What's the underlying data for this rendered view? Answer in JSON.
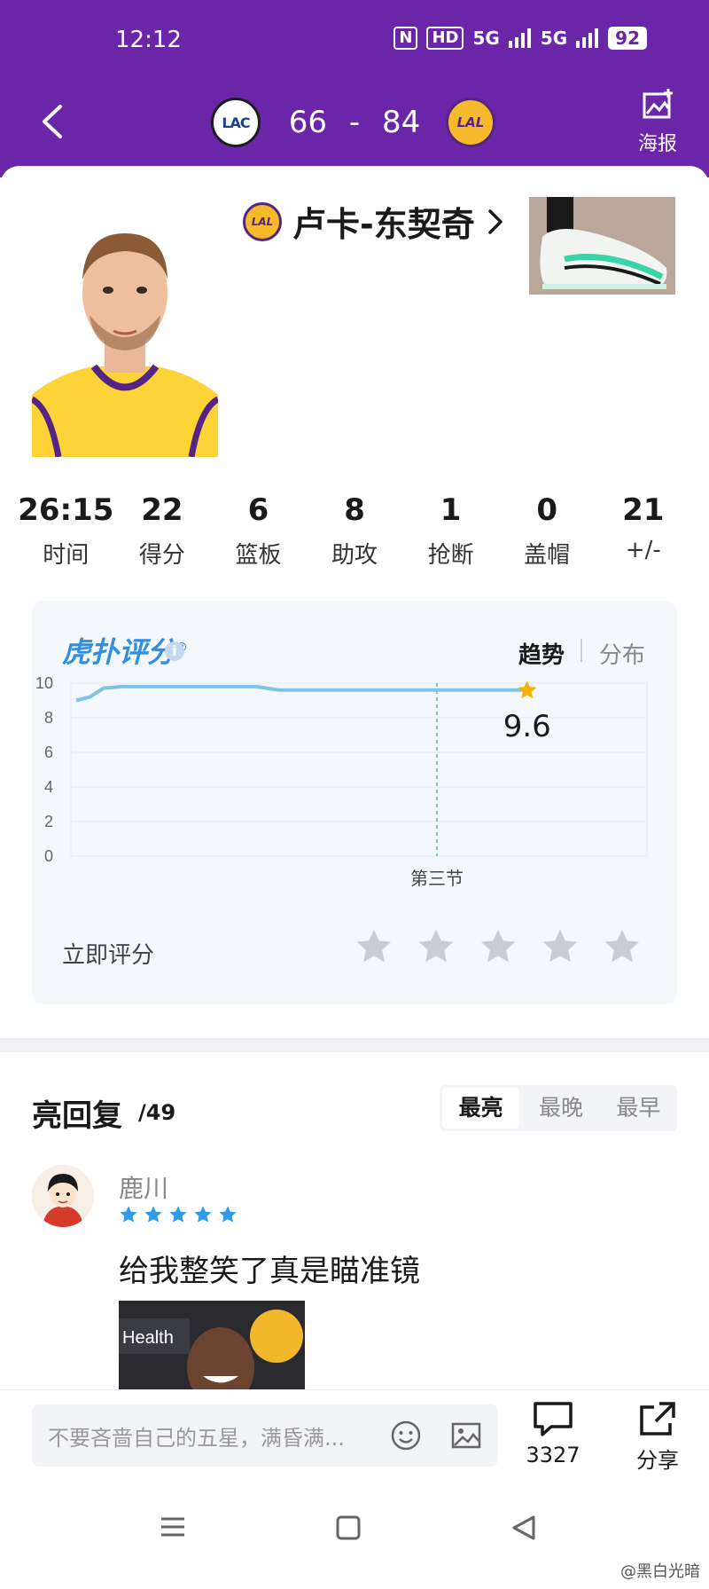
{
  "status_bar": {
    "time": "12:12",
    "nfc": "N",
    "hd": "HD",
    "sig1": "5G",
    "sig2": "5G",
    "battery": "92"
  },
  "header": {
    "home_team_abbr": "LAC",
    "away_team_abbr": "LAL",
    "home_score": "66",
    "score_separator": "-",
    "away_score": "84",
    "poster_label": "海报"
  },
  "player": {
    "name": "卢卡-东契奇",
    "team_abbr": "LAL"
  },
  "stats": [
    {
      "value": "26:15",
      "label": "时间"
    },
    {
      "value": "22",
      "label": "得分"
    },
    {
      "value": "6",
      "label": "篮板"
    },
    {
      "value": "8",
      "label": "助攻"
    },
    {
      "value": "1",
      "label": "抢断"
    },
    {
      "value": "0",
      "label": "盖帽"
    },
    {
      "value": "21",
      "label": "+/-"
    }
  ],
  "rating": {
    "logo_text": "虎扑评分",
    "logo_mark": "®",
    "info_icon": "i",
    "tab_trend": "趋势",
    "tab_distribution": "分布",
    "current_score": "9.6",
    "rate_now_label": "立即评分",
    "user_stars": 0,
    "star_count": 5
  },
  "chart_data": {
    "type": "line",
    "y_ticks": [
      "10",
      "8",
      "6",
      "4",
      "2",
      "0"
    ],
    "ylim": [
      0,
      10
    ],
    "marker_label": "第三节",
    "marker_x": 0.8,
    "series": [
      {
        "x": [
          0,
          0.03,
          0.06,
          0.1,
          0.2,
          0.4,
          0.45,
          0.6,
          0.8,
          1.0
        ],
        "y": [
          9.0,
          9.2,
          9.7,
          9.8,
          9.8,
          9.8,
          9.6,
          9.6,
          9.6,
          9.6
        ]
      }
    ],
    "end_value": "9.6",
    "grid": true
  },
  "comments_section": {
    "title": "亮回复",
    "count": "/49",
    "sort_tabs": [
      "最亮",
      "最晚",
      "最早"
    ],
    "active_sort": 0
  },
  "comments": [
    {
      "user": "鹿川",
      "stars": 5,
      "text": "给我整笑了真是瞄准镜",
      "image_caption": "Health"
    }
  ],
  "input": {
    "placeholder": "不要吝啬自己的五星，满昏满..."
  },
  "actions": {
    "comment_count": "3327",
    "share_label": "分享"
  },
  "watermark": "@黑白光暗",
  "colors": {
    "header_purple": "#6a25a8",
    "rating_blue": "#2f8fe0",
    "star_gold": "#f5b400",
    "star_blue": "#2f9be8",
    "star_grey": "#c9ccd1"
  }
}
